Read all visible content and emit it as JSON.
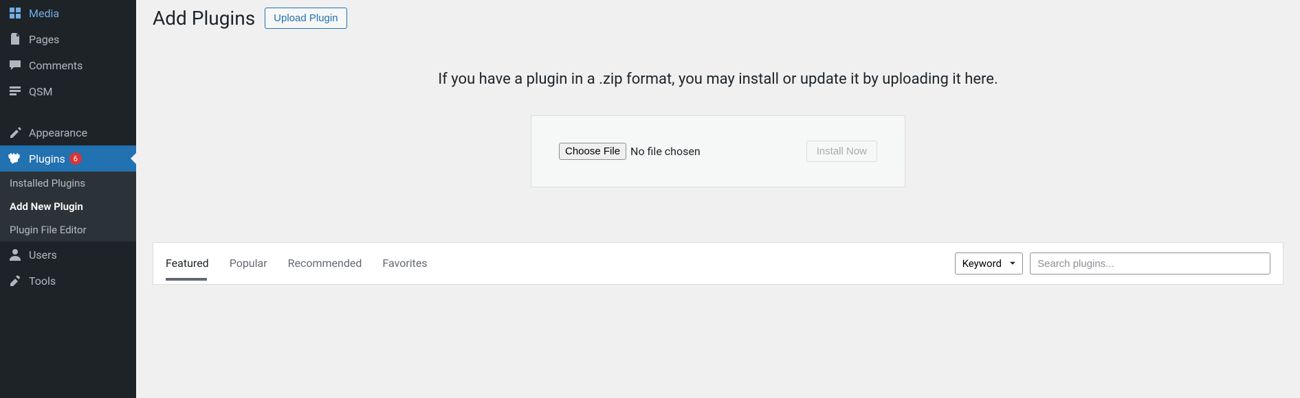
{
  "sidebar": {
    "items": [
      {
        "label": "Media",
        "icon": "media"
      },
      {
        "label": "Pages",
        "icon": "pages"
      },
      {
        "label": "Comments",
        "icon": "comments"
      },
      {
        "label": "QSM",
        "icon": "qsm"
      }
    ],
    "appearance_label": "Appearance",
    "plugins": {
      "label": "Plugins",
      "badge": "6",
      "submenu": {
        "installed": "Installed Plugins",
        "add_new": "Add New Plugin",
        "file_editor": "Plugin File Editor"
      }
    },
    "users_label": "Users",
    "tools_label": "Tools"
  },
  "header": {
    "title": "Add Plugins",
    "upload_button": "Upload Plugin"
  },
  "upload": {
    "description": "If you have a plugin in a .zip format, you may install or update it by uploading it here.",
    "choose_file": "Choose File",
    "file_status": "No file chosen",
    "install_button": "Install Now"
  },
  "filter": {
    "tabs": {
      "featured": "Featured",
      "popular": "Popular",
      "recommended": "Recommended",
      "favorites": "Favorites"
    },
    "select_label": "Keyword",
    "search_placeholder": "Search plugins..."
  }
}
